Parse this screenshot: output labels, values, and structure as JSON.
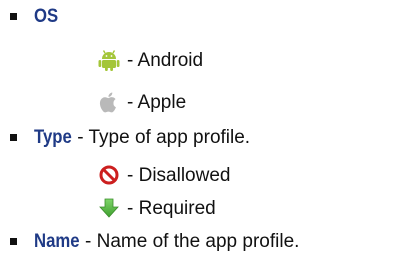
{
  "items": [
    {
      "term": "OS",
      "description": "",
      "sub_items": [
        {
          "icon": "android-icon",
          "label": "- Android",
          "color": "#a4c639"
        },
        {
          "icon": "apple-icon",
          "label": "- Apple",
          "color": "#b9b9b9"
        }
      ]
    },
    {
      "term": "Type",
      "description": " - Type of app profile.",
      "sub_items": [
        {
          "icon": "disallowed-icon",
          "label": "- Disallowed",
          "color": "#cc1f1f"
        },
        {
          "icon": "required-arrow-icon",
          "label": "- Required",
          "color": "#4caf3a"
        }
      ]
    },
    {
      "term": "Name",
      "description": " - Name of the app profile.",
      "sub_items": []
    }
  ],
  "colors": {
    "term": "#1f3a86",
    "text": "#111111",
    "bullet": "#111111"
  }
}
